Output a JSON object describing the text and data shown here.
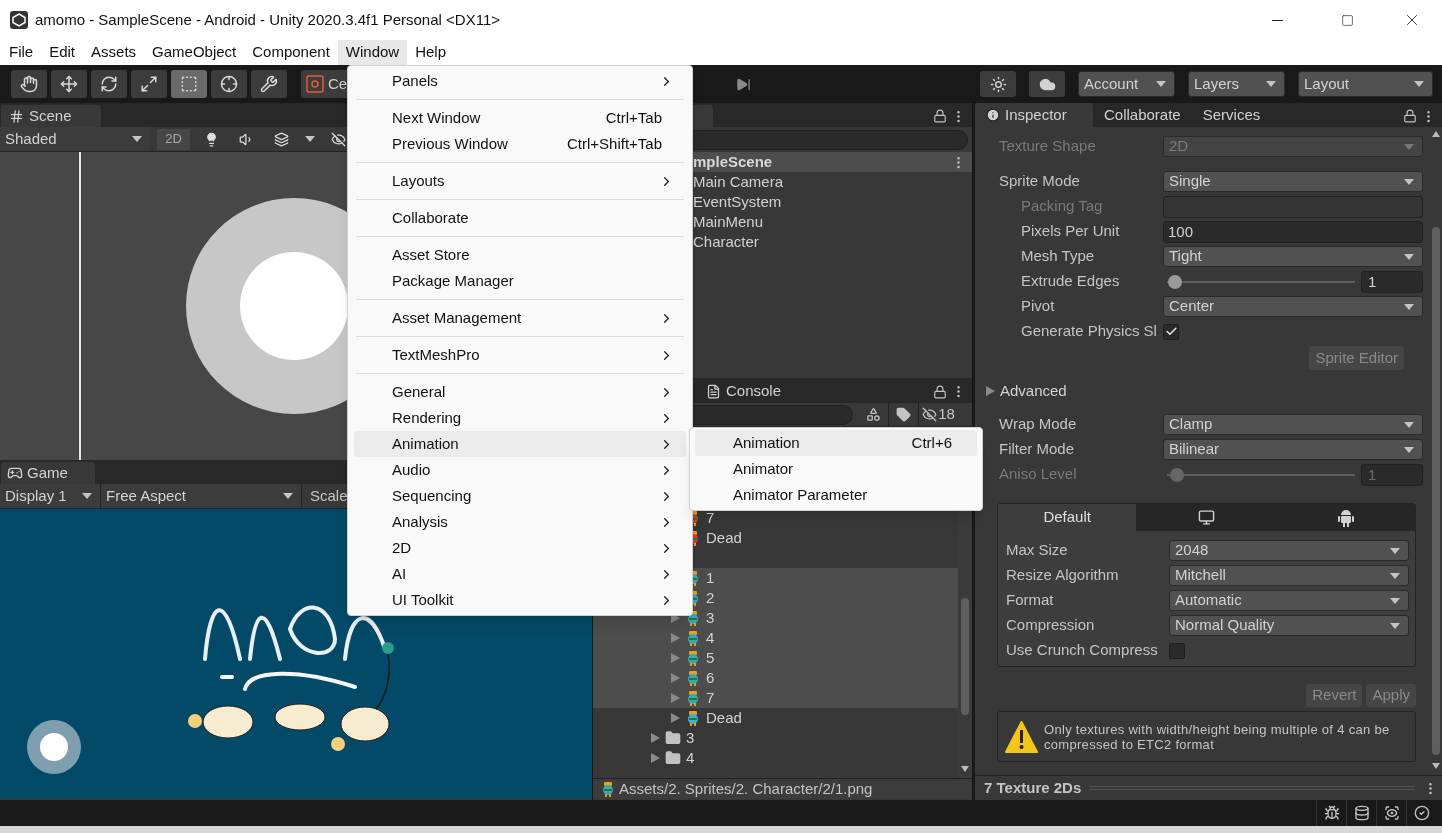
{
  "window": {
    "title": "amomo - SampleScene - Android - Unity 2020.3.4f1 Personal <DX11>"
  },
  "menu_bar": [
    {
      "label": "File",
      "selected": false
    },
    {
      "label": "Edit",
      "selected": false
    },
    {
      "label": "Assets",
      "selected": false
    },
    {
      "label": "GameObject",
      "selected": false
    },
    {
      "label": "Component",
      "selected": false
    },
    {
      "label": "Window",
      "selected": true
    },
    {
      "label": "Help",
      "selected": false
    }
  ],
  "toolbar": {
    "tools": [
      {
        "kind": "hand",
        "selected": false
      },
      {
        "kind": "move",
        "selected": false
      },
      {
        "kind": "rotate",
        "selected": false
      },
      {
        "kind": "scale",
        "selected": false
      },
      {
        "kind": "rect",
        "selected": true
      },
      {
        "kind": "transform",
        "selected": false
      },
      {
        "kind": "custom",
        "selected": false
      }
    ],
    "pivot_button": "Ce",
    "account": "Account",
    "layers": "Layers",
    "layout": "Layout"
  },
  "scene": {
    "tab": "Scene",
    "shading": "Shaded",
    "mode_2d": "2D"
  },
  "game": {
    "tab": "Game",
    "display": "Display 1",
    "aspect": "Free Aspect",
    "scale": "Scale"
  },
  "hierarchy": {
    "scene": "mpleScene",
    "items": [
      "Main Camera",
      "EventSystem",
      "MainMenu",
      "Character"
    ]
  },
  "console": {
    "tab": "Console",
    "count": "18"
  },
  "project": {
    "tree": [
      {
        "children": [
          {
            "label": "7",
            "kind": "sprite",
            "color": "#c8403a",
            "selected": false
          },
          {
            "label": "Dead",
            "kind": "sprite",
            "color": "#d83a2e",
            "selected": false
          }
        ]
      },
      {
        "children": [
          {
            "label": "1",
            "kind": "sprite",
            "color": "#3aa6b9",
            "selected": true
          },
          {
            "label": "2",
            "kind": "sprite",
            "color": "#3aa6b9",
            "selected": true
          },
          {
            "label": "3",
            "kind": "sprite",
            "color": "#3aa6b9",
            "selected": true
          },
          {
            "label": "4",
            "kind": "sprite",
            "color": "#3aa6b9",
            "selected": true
          },
          {
            "label": "5",
            "kind": "sprite",
            "color": "#3aa6b9",
            "selected": true
          },
          {
            "label": "6",
            "kind": "sprite",
            "color": "#3aa6b9",
            "selected": true
          },
          {
            "label": "7",
            "kind": "sprite",
            "color": "#3aa6b9",
            "selected": true
          },
          {
            "label": "Dead",
            "kind": "sprite",
            "color": "#3fb0d0",
            "selected": false
          }
        ]
      },
      {
        "label": "3",
        "kind": "folder",
        "selected": false
      },
      {
        "label": "4",
        "kind": "folder",
        "selected": false
      }
    ],
    "path": "Assets/2. Sprites/2. Character/2/1.png"
  },
  "window_menu": {
    "items": [
      {
        "kind": "item",
        "label": "Panels",
        "submenu": true,
        "selected": false
      },
      {
        "kind": "separator"
      },
      {
        "kind": "item",
        "label": "Next Window",
        "shortcut": "Ctrl+Tab",
        "submenu": false,
        "selected": false
      },
      {
        "kind": "item",
        "label": "Previous Window",
        "shortcut": "Ctrl+Shift+Tab",
        "submenu": false,
        "selected": false
      },
      {
        "kind": "separator"
      },
      {
        "kind": "item",
        "label": "Layouts",
        "submenu": true,
        "selected": false
      },
      {
        "kind": "separator"
      },
      {
        "kind": "item",
        "label": "Collaborate",
        "submenu": false,
        "selected": false
      },
      {
        "kind": "separator"
      },
      {
        "kind": "item",
        "label": "Asset Store",
        "submenu": false,
        "selected": false
      },
      {
        "kind": "item",
        "label": "Package Manager",
        "submenu": false,
        "selected": false
      },
      {
        "kind": "separator"
      },
      {
        "kind": "item",
        "label": "Asset Management",
        "submenu": true,
        "selected": false
      },
      {
        "kind": "separator"
      },
      {
        "kind": "item",
        "label": "TextMeshPro",
        "submenu": true,
        "selected": false
      },
      {
        "kind": "separator"
      },
      {
        "kind": "item",
        "label": "General",
        "submenu": true,
        "selected": false
      },
      {
        "kind": "item",
        "label": "Rendering",
        "submenu": true,
        "selected": false
      },
      {
        "kind": "item",
        "label": "Animation",
        "submenu": true,
        "selected": true
      },
      {
        "kind": "item",
        "label": "Audio",
        "submenu": true,
        "selected": false
      },
      {
        "kind": "item",
        "label": "Sequencing",
        "submenu": true,
        "selected": false
      },
      {
        "kind": "item",
        "label": "Analysis",
        "submenu": true,
        "selected": false
      },
      {
        "kind": "item",
        "label": "2D",
        "submenu": true,
        "selected": false
      },
      {
        "kind": "item",
        "label": "AI",
        "submenu": true,
        "selected": false
      },
      {
        "kind": "item",
        "label": "UI Toolkit",
        "submenu": true,
        "selected": false
      }
    ],
    "submenu": [
      {
        "label": "Animation",
        "shortcut": "Ctrl+6",
        "selected": true
      },
      {
        "label": "Animator",
        "selected": false
      },
      {
        "label": "Animator Parameter",
        "selected": false
      }
    ]
  },
  "inspector": {
    "tabs": [
      {
        "label": "Inspector",
        "selected": true
      },
      {
        "label": "Collaborate",
        "selected": false
      },
      {
        "label": "Services",
        "selected": false
      }
    ],
    "fields": [
      {
        "kind": "dropdown",
        "label": "Texture Shape",
        "value": "2D",
        "disabled": true
      },
      {
        "kind": "dropdown",
        "label": "Sprite Mode",
        "value": "Single",
        "disabled": false,
        "children": [
          {
            "kind": "text",
            "label": "Packing Tag",
            "disabled": true
          },
          {
            "kind": "text",
            "label": "Pixels Per Unit",
            "value": "100",
            "disabled": false
          },
          {
            "kind": "dropdown",
            "label": "Mesh Type",
            "value": "Tight",
            "disabled": false
          },
          {
            "kind": "slider",
            "label": "Extrude Edges",
            "value": "1",
            "level": 0.03,
            "disabled": false
          },
          {
            "kind": "dropdown",
            "label": "Pivot",
            "value": "Center",
            "disabled": false
          },
          {
            "kind": "checkbox",
            "label": "Generate Physics Sl",
            "checked": true,
            "disabled": false
          }
        ]
      },
      {
        "kind": "button",
        "label": "Sprite Editor",
        "disabled": true
      },
      {
        "kind": "foldout",
        "label": "Advanced",
        "expanded": false
      },
      {
        "kind": "dropdown",
        "label": "Wrap Mode",
        "value": "Clamp",
        "disabled": false
      },
      {
        "kind": "dropdown",
        "label": "Filter Mode",
        "value": "Bilinear",
        "disabled": false
      },
      {
        "kind": "slider",
        "label": "Aniso Level",
        "value": "1",
        "level": 0.04,
        "disabled": true
      }
    ],
    "platform_tabs": [
      {
        "kind": "text",
        "label": "Default",
        "selected": true
      },
      {
        "kind": "monitor",
        "selected": false
      },
      {
        "kind": "android",
        "selected": false
      }
    ],
    "platform_fields": [
      {
        "kind": "dropdown",
        "label": "Max Size",
        "value": "2048"
      },
      {
        "kind": "dropdown",
        "label": "Resize Algorithm",
        "value": "Mitchell"
      },
      {
        "kind": "dropdown",
        "label": "Format",
        "value": "Automatic"
      },
      {
        "kind": "dropdown",
        "label": "Compression",
        "value": "Normal Quality"
      },
      {
        "kind": "checkbox",
        "label": "Use Crunch Compress",
        "checked": false
      }
    ],
    "actions": [
      {
        "label": "Revert",
        "disabled": true
      },
      {
        "label": "Apply",
        "disabled": true
      }
    ],
    "warning": "Only textures with width/height being multiple of 4 can be compressed to ETC2 format",
    "footer": "7 Texture 2Ds"
  }
}
